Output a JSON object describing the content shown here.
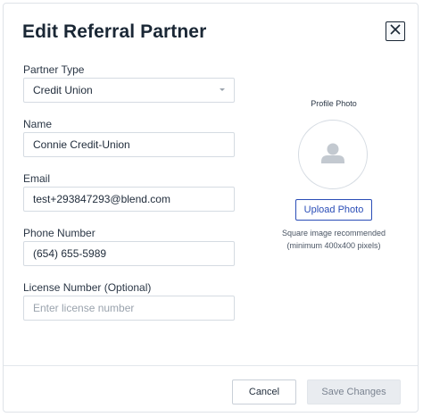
{
  "modal": {
    "title": "Edit Referral Partner"
  },
  "fields": {
    "partner_type": {
      "label": "Partner Type",
      "value": "Credit Union"
    },
    "name": {
      "label": "Name",
      "value": "Connie Credit-Union"
    },
    "email": {
      "label": "Email",
      "value": "test+293847293@blend.com"
    },
    "phone": {
      "label": "Phone Number",
      "value": "(654) 655-5989"
    },
    "license": {
      "label": "License Number (Optional)",
      "value": "",
      "placeholder": "Enter license number"
    }
  },
  "profile_photo": {
    "label": "Profile Photo",
    "upload_label": "Upload Photo",
    "hint_line1": "Square image recommended",
    "hint_line2": "(minimum 400x400 pixels)"
  },
  "footer": {
    "cancel_label": "Cancel",
    "save_label": "Save Changes"
  },
  "icons": {
    "close": "close-icon",
    "avatar": "user-placeholder-icon",
    "dropdown": "chevron-down-icon"
  },
  "colors": {
    "primary": "#2a4db7",
    "title_text": "#1a2735",
    "disabled_bg": "#e9ecf0",
    "disabled_text": "#7a8390"
  }
}
